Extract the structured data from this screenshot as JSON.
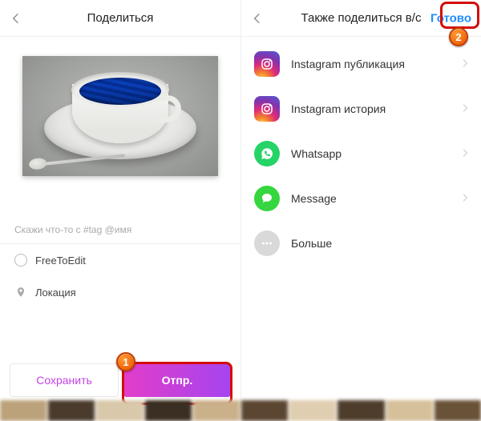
{
  "left": {
    "title": "Поделиться",
    "caption_placeholder": "Скажи что-то с #tag @имя",
    "free_to_edit": "FreeToEdit",
    "location": "Локация",
    "save": "Сохранить",
    "send": "Отпр."
  },
  "right": {
    "title": "Также поделиться в/с",
    "done": "Готово",
    "items": [
      {
        "label": "Instagram публикация"
      },
      {
        "label": "Instagram история"
      },
      {
        "label": "Whatsapp"
      },
      {
        "label": "Message"
      },
      {
        "label": "Больше"
      }
    ]
  },
  "callouts": {
    "b1": "1",
    "b2": "2"
  }
}
